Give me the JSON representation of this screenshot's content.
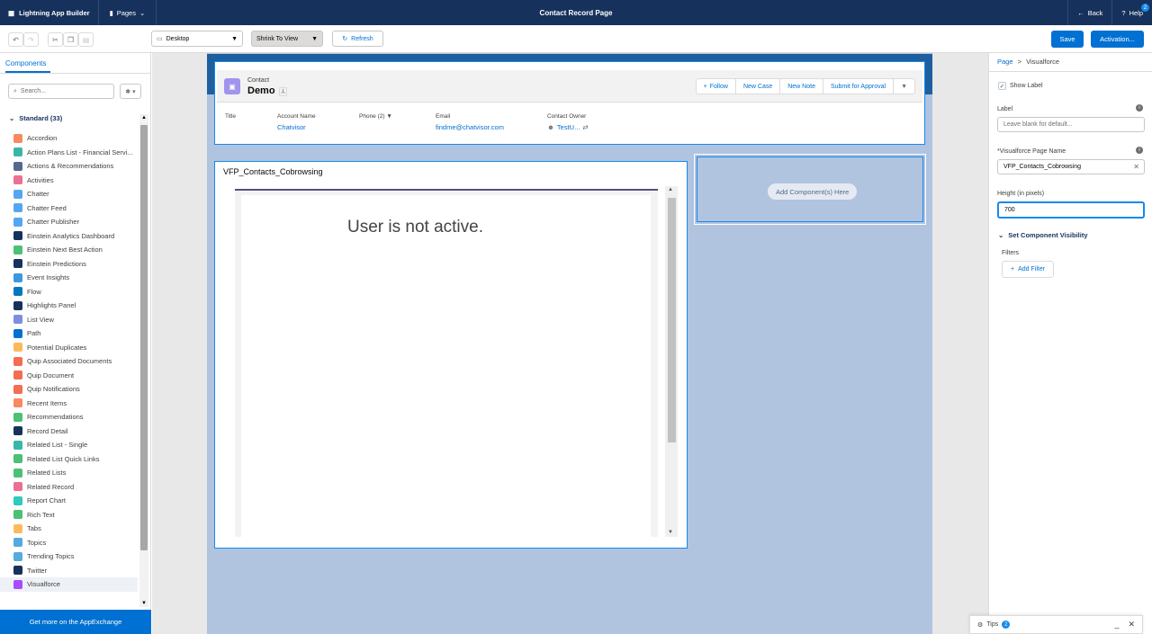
{
  "topbar": {
    "app_name": "Lightning App Builder",
    "pages_label": "Pages",
    "title": "Contact Record Page",
    "back_label": "Back",
    "help_label": "Help",
    "help_badge": "2"
  },
  "toolbar": {
    "device_select": "Desktop",
    "view_select": "Shrink To View",
    "refresh_label": "Refresh",
    "save_label": "Save",
    "activation_label": "Activation..."
  },
  "left_panel": {
    "tab_label": "Components",
    "search_placeholder": "Search...",
    "section_label": "Standard (33)",
    "components": [
      {
        "label": "Accordion",
        "color": "#f88962"
      },
      {
        "label": "Action Plans List - Financial Servi...",
        "color": "#3bb6a6"
      },
      {
        "label": "Actions & Recommendations",
        "color": "#54698d"
      },
      {
        "label": "Activities",
        "color": "#eb7092"
      },
      {
        "label": "Chatter",
        "color": "#54a6f4"
      },
      {
        "label": "Chatter Feed",
        "color": "#54a6f4"
      },
      {
        "label": "Chatter Publisher",
        "color": "#54a6f4"
      },
      {
        "label": "Einstein Analytics Dashboard",
        "color": "#16325c"
      },
      {
        "label": "Einstein Next Best Action",
        "color": "#4bc076"
      },
      {
        "label": "Einstein Predictions",
        "color": "#16325c"
      },
      {
        "label": "Event Insights",
        "color": "#3c97dd"
      },
      {
        "label": "Flow",
        "color": "#0079bc"
      },
      {
        "label": "Highlights Panel",
        "color": "#16325c"
      },
      {
        "label": "List View",
        "color": "#7f8de1"
      },
      {
        "label": "Path",
        "color": "#0070d2"
      },
      {
        "label": "Potential Duplicates",
        "color": "#fcb95b"
      },
      {
        "label": "Quip Associated Documents",
        "color": "#f26d52"
      },
      {
        "label": "Quip Document",
        "color": "#f26d52"
      },
      {
        "label": "Quip Notifications",
        "color": "#f26d52"
      },
      {
        "label": "Recent Items",
        "color": "#f88962"
      },
      {
        "label": "Recommendations",
        "color": "#4bc076"
      },
      {
        "label": "Record Detail",
        "color": "#16325c"
      },
      {
        "label": "Related List - Single",
        "color": "#3bb6a6"
      },
      {
        "label": "Related List Quick Links",
        "color": "#4bc076"
      },
      {
        "label": "Related Lists",
        "color": "#4bc076"
      },
      {
        "label": "Related Record",
        "color": "#eb7092"
      },
      {
        "label": "Report Chart",
        "color": "#2ecbbe"
      },
      {
        "label": "Rich Text",
        "color": "#4bc076"
      },
      {
        "label": "Tabs",
        "color": "#fcb95b"
      },
      {
        "label": "Topics",
        "color": "#56aadf"
      },
      {
        "label": "Trending Topics",
        "color": "#56aadf"
      },
      {
        "label": "Twitter",
        "color": "#16325c"
      },
      {
        "label": "Visualforce",
        "color": "#a94cff"
      }
    ],
    "appexchange_label": "Get more on the AppExchange"
  },
  "highlights": {
    "object_label": "Contact",
    "record_name": "Demo",
    "actions": [
      "Follow",
      "New Case",
      "New Note",
      "Submit for Approval"
    ],
    "fields": [
      {
        "label": "Title",
        "value": ""
      },
      {
        "label": "Account Name",
        "value": "Chatvisor"
      },
      {
        "label": "Phone (2)",
        "value": ""
      },
      {
        "label": "Email",
        "value": "findme@chatvisor.com"
      },
      {
        "label": "Contact Owner",
        "value": "TestU..."
      }
    ]
  },
  "visualforce_card": {
    "title": "VFP_Contacts_Cobrowsing",
    "message": "User is not active."
  },
  "empty_region": {
    "add_label": "Add Component(s) Here"
  },
  "right_panel": {
    "breadcrumb_page": "Page",
    "breadcrumb_sep": ">",
    "breadcrumb_current": "Visualforce",
    "show_label": "Show Label",
    "label_field": "Label",
    "label_placeholder": "Leave blank for default...",
    "page_name_field": "*Visualforce Page Name",
    "page_name_value": "VFP_Contacts_Cobrowsing",
    "height_field": "Height (in pixels)",
    "height_value": "700",
    "visibility_label": "Set Component Visibility",
    "filters_label": "Filters",
    "add_filter_label": "Add Filter"
  },
  "tips": {
    "label": "Tips",
    "count": "2"
  }
}
